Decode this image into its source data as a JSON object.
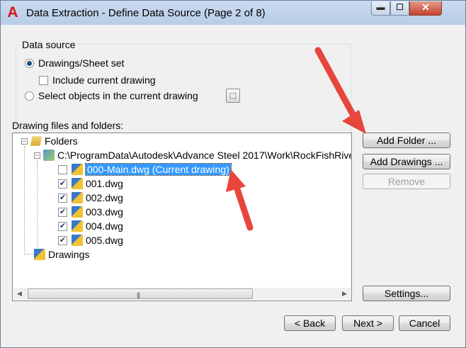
{
  "window": {
    "title": "Data Extraction - Define Data Source (Page 2 of 8)",
    "app_icon_letter": "A",
    "controls": {
      "minimize": "▬",
      "maximize": "☐",
      "close": "✕"
    }
  },
  "data_source": {
    "group_label": "Data source",
    "option_drawings": "Drawings/Sheet set",
    "include_current": "Include current drawing",
    "option_select": "Select objects in the current drawing",
    "selected_option": "drawings"
  },
  "files": {
    "label": "Drawing files and folders:",
    "folders_label": "Folders",
    "path": "C:\\ProgramData\\Autodesk\\Advance Steel 2017\\Work\\RockFishRive",
    "items": [
      {
        "name": "000-Main.dwg (Current drawing)",
        "checked": false,
        "selected": true
      },
      {
        "name": "001.dwg",
        "checked": true,
        "selected": false
      },
      {
        "name": "002.dwg",
        "checked": true,
        "selected": false
      },
      {
        "name": "003.dwg",
        "checked": true,
        "selected": false
      },
      {
        "name": "004.dwg",
        "checked": true,
        "selected": false
      },
      {
        "name": "005.dwg",
        "checked": true,
        "selected": false
      }
    ],
    "drawings_label": "Drawings",
    "collapse_glyph": "−"
  },
  "side_buttons": {
    "add_folder": "Add Folder ...",
    "add_drawings": "Add Drawings ...",
    "remove": "Remove",
    "settings": "Settings..."
  },
  "footer": {
    "back": "< Back",
    "next": "Next >",
    "cancel": "Cancel"
  },
  "annotation_color": "#e8453c"
}
